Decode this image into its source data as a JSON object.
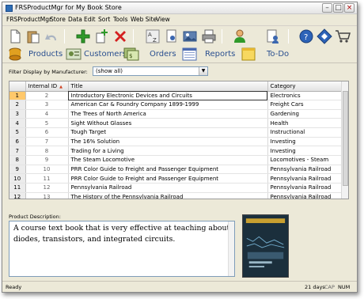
{
  "window": {
    "title": "FRSProductMgr for My Book Store"
  },
  "menu": [
    "FRSProductMgr",
    "Store",
    "Data",
    "Edit",
    "Sort",
    "Tools",
    "Web Site",
    "View"
  ],
  "nav": {
    "products": "Products",
    "customers": "Customers",
    "orders": "Orders",
    "reports": "Reports",
    "todo": "To-Do"
  },
  "filter": {
    "label": "Filter Display by Manufacturer:",
    "value": "(show all)"
  },
  "grid": {
    "headers": {
      "internal_id": "Internal ID",
      "title": "Title",
      "category": "Category"
    },
    "rows": [
      {
        "n": "1",
        "id": "2",
        "title": "Introductory Electronic Devices and Circuits",
        "category": "Electronics"
      },
      {
        "n": "2",
        "id": "3",
        "title": "American Car & Foundry Company 1899-1999",
        "category": "Freight Cars"
      },
      {
        "n": "3",
        "id": "4",
        "title": "The Trees of North America",
        "category": "Gardening"
      },
      {
        "n": "4",
        "id": "5",
        "title": "Sight Without Glasses",
        "category": "Health"
      },
      {
        "n": "5",
        "id": "6",
        "title": "Tough Target",
        "category": "Instructional"
      },
      {
        "n": "6",
        "id": "7",
        "title": "The 16% Solution",
        "category": "Investing"
      },
      {
        "n": "7",
        "id": "8",
        "title": "Trading for a Living",
        "category": "Investing"
      },
      {
        "n": "8",
        "id": "9",
        "title": "The Steam Locomotive",
        "category": "Locomotives - Steam"
      },
      {
        "n": "9",
        "id": "10",
        "title": "PRR Color Guide to Freight and Passenger Equipment",
        "category": "Pennsylvania Railroad"
      },
      {
        "n": "10",
        "id": "11",
        "title": "PRR Color Guide to Freight and Passenger Equipment",
        "category": "Pennsylvania Railroad"
      },
      {
        "n": "11",
        "id": "12",
        "title": "Pennsylvania Railroad",
        "category": "Pennsylvania Railroad"
      },
      {
        "n": "12",
        "id": "13",
        "title": "The History of the Pennsylvania Railroad",
        "category": "Pennsylvania Railroad"
      }
    ]
  },
  "description": {
    "label": "Product Description:",
    "text": "A course text book that is very effective at teaching about diodes, transistors, and integrated circuits."
  },
  "status": {
    "ready": "Ready",
    "days": "21 days",
    "cap": "CAP",
    "num": "NUM"
  },
  "colors": {
    "nav_text": "#2a4f8f",
    "selected_row": "#ffc86b",
    "add_green": "#2f9a2a",
    "delete_red": "#d42020"
  },
  "icons": [
    "new-page-icon",
    "paste-icon",
    "undo-icon",
    "add-icon",
    "duplicate-icon",
    "delete-icon",
    "sort-az-icon",
    "search-user-icon",
    "image-icon",
    "print-icon",
    "user-icon",
    "document-user-icon",
    "help-icon",
    "diamond-icon",
    "cart-icon"
  ]
}
